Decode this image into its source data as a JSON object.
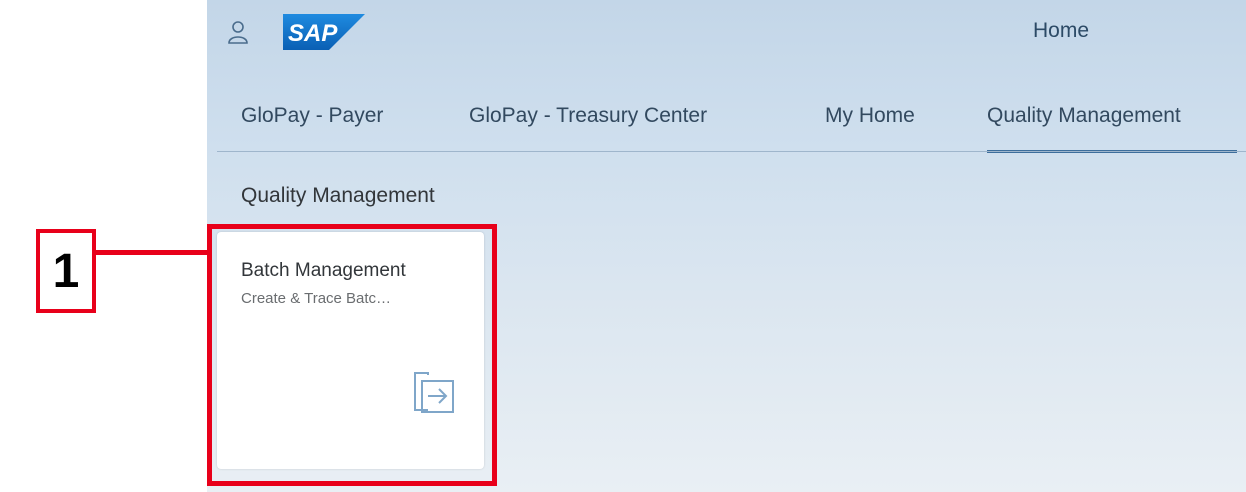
{
  "shell": {
    "title": "Home",
    "logo_text": "SAP",
    "brand_color": "#0a6ed1",
    "user_icon": "person-icon"
  },
  "tabs": [
    {
      "label": "GloPay - Payer",
      "selected": false
    },
    {
      "label": "GloPay - Treasury Center",
      "selected": false
    },
    {
      "label": "My Home",
      "selected": false
    },
    {
      "label": "Quality Management",
      "selected": true
    }
  ],
  "group": {
    "title": "Quality Management"
  },
  "tiles": [
    {
      "title": "Batch Management",
      "subtitle": "Create & Trace Batc…",
      "icon": "launch-app-icon"
    }
  ],
  "annotation": {
    "callout_label": "1",
    "highlight_color": "#e8001a"
  }
}
